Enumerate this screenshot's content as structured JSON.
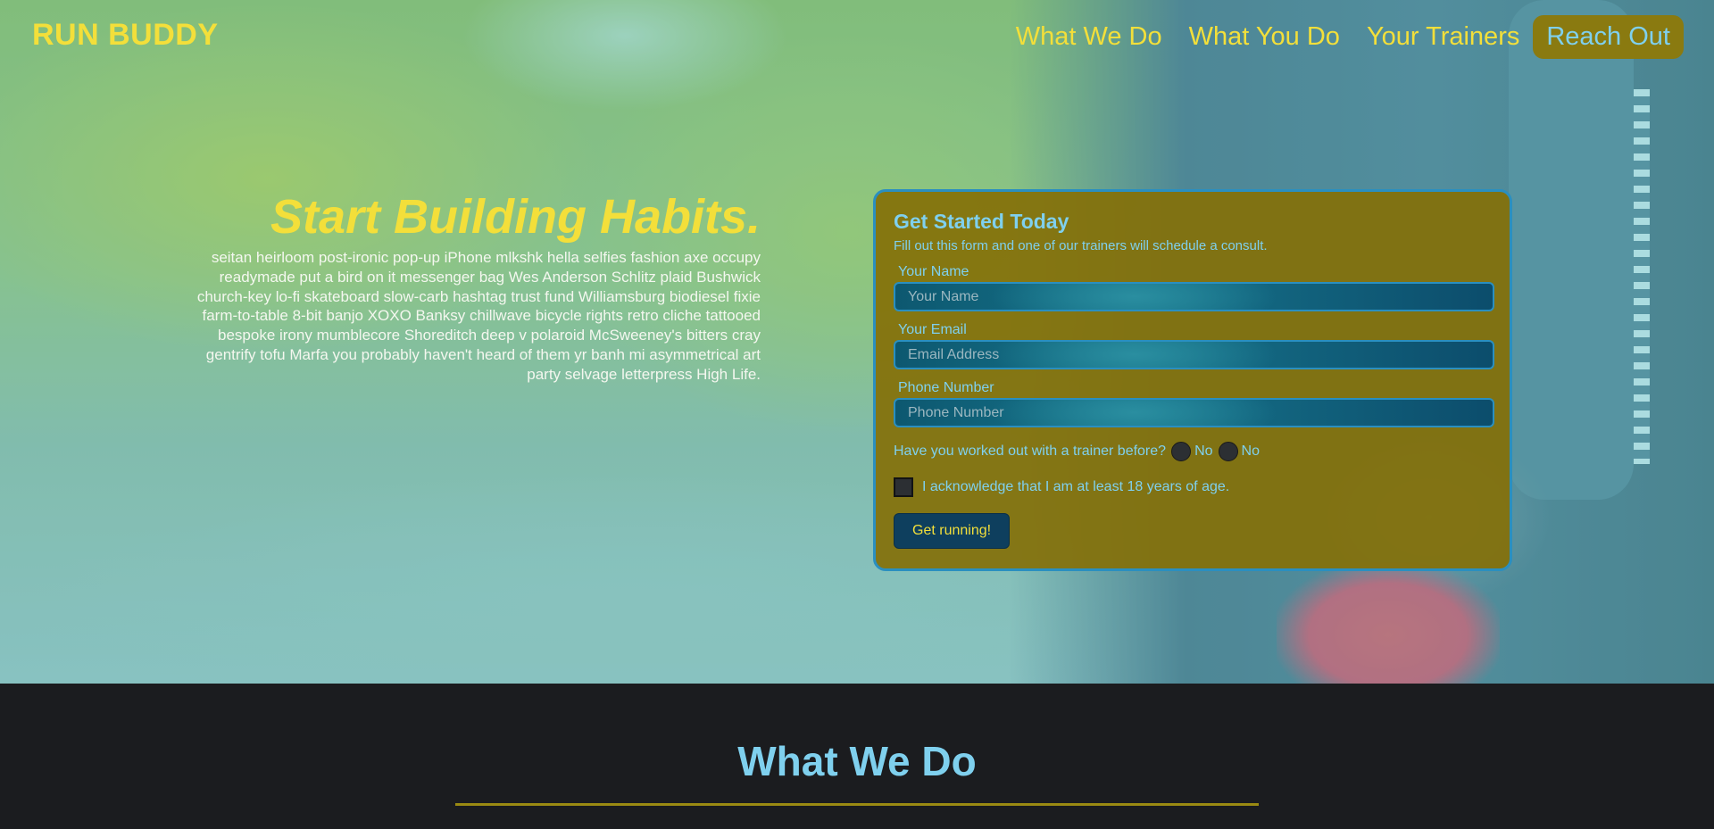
{
  "brand": {
    "logo": "RUN BUDDY",
    "accent": "#f3df3a",
    "secondary": "#7fd0ee"
  },
  "nav": {
    "items": [
      {
        "label": "What We Do"
      },
      {
        "label": "What You Do"
      },
      {
        "label": "Your Trainers"
      },
      {
        "label": "Reach Out"
      }
    ]
  },
  "hero": {
    "heading": "Start Building Habits.",
    "body": "seitan heirloom post-ironic pop-up iPhone mlkshk hella selfies fashion axe occupy readymade put a bird on it messenger bag Wes Anderson Schlitz plaid Bushwick church-key lo-fi skateboard slow-carb hashtag trust fund Williamsburg biodiesel fixie farm-to-table 8-bit banjo XOXO Banksy chillwave bicycle rights retro cliche tattooed bespoke irony mumblecore Shoreditch deep v polaroid McSweeney's bitters cray gentrify tofu Marfa you probably haven't heard of them yr banh mi asymmetrical art party selvage letterpress High Life."
  },
  "form": {
    "title": "Get Started Today",
    "subtitle": "Fill out this form and one of our trainers will schedule a consult.",
    "name_label": "Your Name",
    "name_placeholder": "Your Name",
    "email_label": "Your Email",
    "email_placeholder": "Email Address",
    "phone_label": "Phone Number",
    "phone_placeholder": "Phone Number",
    "question": "Have you worked out with a trainer before?",
    "option_1": "No",
    "option_2": "No",
    "acknowledge": "I acknowledge that I am at least 18 years of age.",
    "submit": "Get running!"
  },
  "section": {
    "title": "What We Do"
  }
}
